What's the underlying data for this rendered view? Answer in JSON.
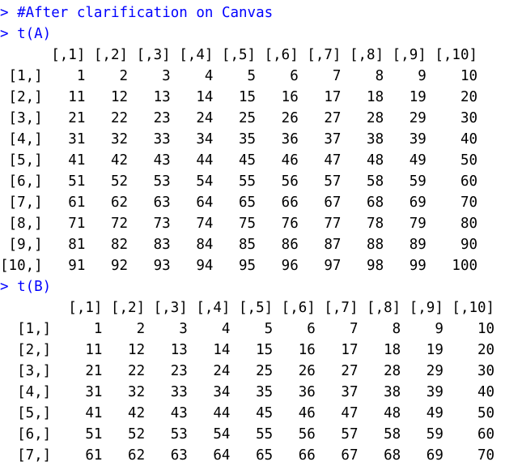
{
  "theme": {
    "command_color": "#0000ff",
    "output_color": "#000000",
    "background": "#ffffff"
  },
  "prompt": "> ",
  "commands": [
    "#After clarification on Canvas",
    "t(A)",
    "t(B)"
  ],
  "outputs": {
    "tA": "      [,1] [,2] [,3] [,4] [,5] [,6] [,7] [,8] [,9] [,10]\n [1,]    1    2    3    4    5    6    7    8    9    10\n [2,]   11   12   13   14   15   16   17   18   19    20\n [3,]   21   22   23   24   25   26   27   28   29    30\n [4,]   31   32   33   34   35   36   37   38   39    40\n [5,]   41   42   43   44   45   46   47   48   49    50\n [6,]   51   52   53   54   55   56   57   58   59    60\n [7,]   61   62   63   64   65   66   67   68   69    70\n [8,]   71   72   73   74   75   76   77   78   79    80\n [9,]   81   82   83   84   85   86   87   88   89    90\n[10,]   91   92   93   94   95   96   97   98   99   100",
    "tB": "        [,1] [,2] [,3] [,4] [,5] [,6] [,7] [,8] [,9] [,10]\n  [1,]     1    2    3    4    5    6    7    8    9    10\n  [2,]    11   12   13   14   15   16   17   18   19    20\n  [3,]    21   22   23   24   25   26   27   28   29    30\n  [4,]    31   32   33   34   35   36   37   38   39    40\n  [5,]    41   42   43   44   45   46   47   48   49    50\n  [6,]    51   52   53   54   55   56   57   58   59    60\n  [7,]    61   62   63   64   65   66   67   68   69    70"
  }
}
